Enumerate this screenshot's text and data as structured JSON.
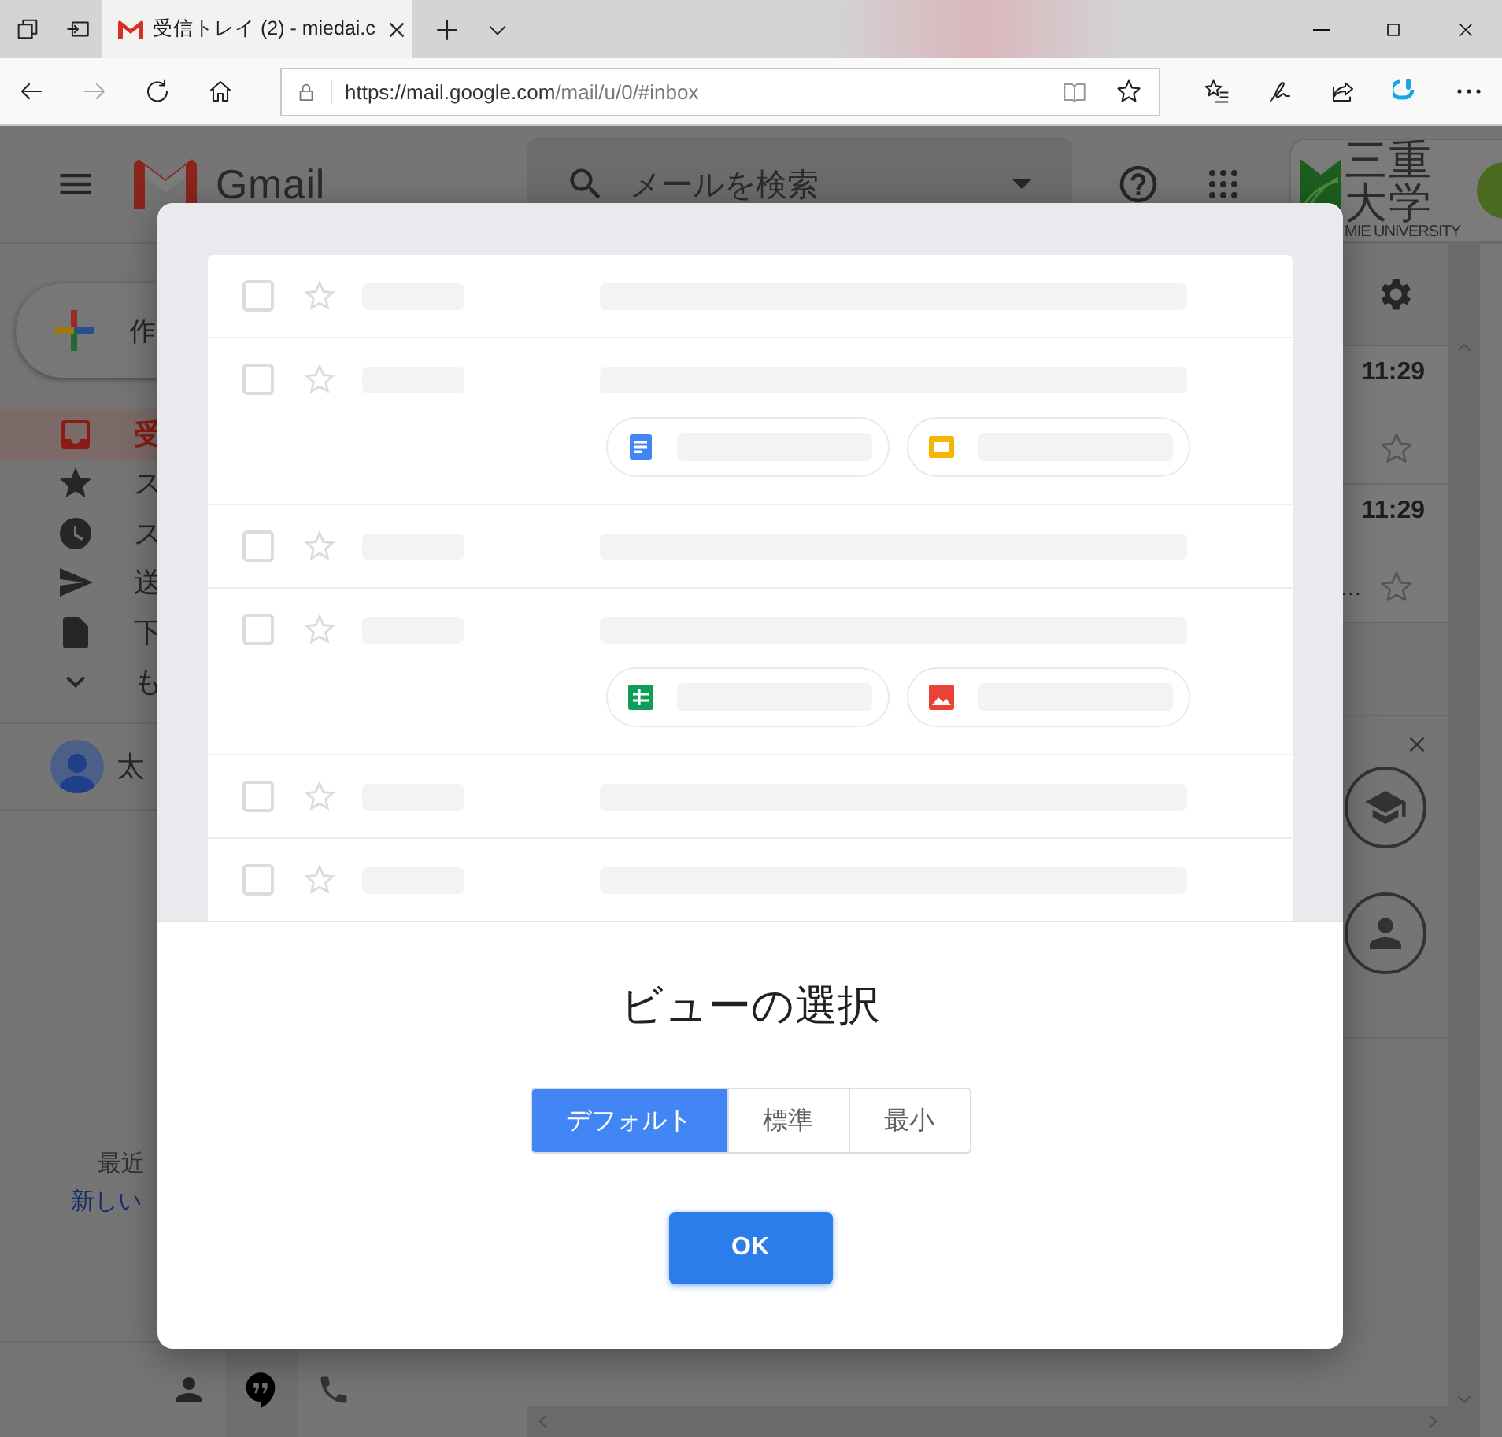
{
  "browser": {
    "tab_title": "受信トレイ (2) - miedai.c",
    "url_host": "https://mail.google.com",
    "url_path": "/mail/u/0/#inbox"
  },
  "gmail": {
    "logo": "Gmail",
    "search_placeholder": "メールを検索",
    "org_name": "三重大学",
    "org_subtitle": "MIE UNIVERSITY",
    "compose": "作",
    "nav": [
      {
        "kind": "inbox",
        "label": "受",
        "selected": true
      },
      {
        "kind": "starred",
        "label": "ス",
        "selected": false
      },
      {
        "kind": "snoozed",
        "label": "ス",
        "selected": false
      },
      {
        "kind": "sent",
        "label": "送",
        "selected": false
      },
      {
        "kind": "drafts",
        "label": "下",
        "selected": false
      },
      {
        "kind": "more",
        "label": "も",
        "selected": false
      }
    ],
    "account": "太",
    "hangouts_note": "最近",
    "hangouts_link": "新しい",
    "mail_times": [
      "11:29",
      "11:29"
    ],
    "snippet_tail": "…"
  },
  "dialog": {
    "preview_rows": [
      {},
      {
        "attachments": [
          {
            "kind": "doc"
          },
          {
            "kind": "slides"
          }
        ]
      },
      {},
      {
        "attachments": [
          {
            "kind": "sheet"
          },
          {
            "kind": "image"
          }
        ]
      },
      {},
      {}
    ],
    "title": "ビューの選択",
    "options": [
      {
        "label": "デフォルト",
        "selected": true
      },
      {
        "label": "標準",
        "selected": false
      },
      {
        "label": "最小",
        "selected": false
      }
    ],
    "ok": "OK"
  }
}
